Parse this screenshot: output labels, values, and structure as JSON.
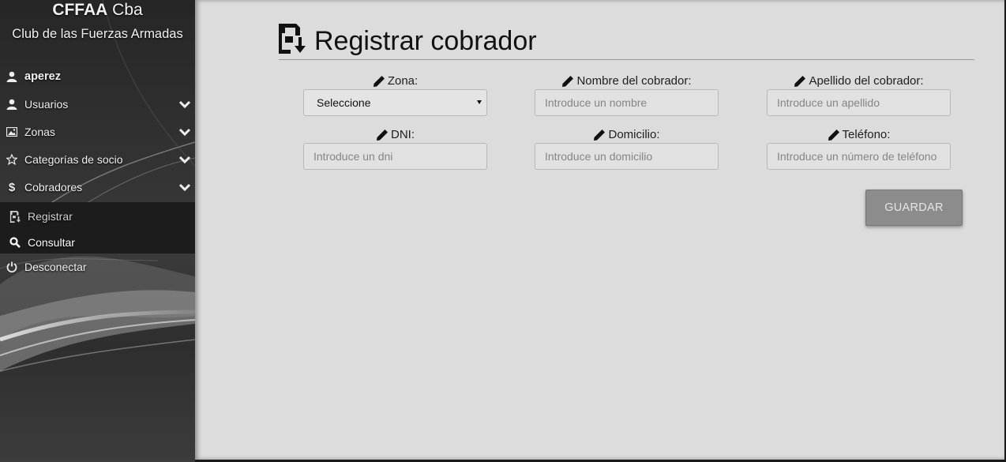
{
  "brand": {
    "title_bold": "CFFAA",
    "title_rest": " Cba",
    "subtitle": "Club de las Fuerzas Armadas"
  },
  "user": {
    "name": "aperez",
    "icon": "user-icon"
  },
  "nav": [
    {
      "label": "Usuarios",
      "icon": "user-icon"
    },
    {
      "label": "Zonas",
      "icon": "picture-icon"
    },
    {
      "label": "Categorías de socio",
      "icon": "star-icon"
    },
    {
      "label": "Cobradores",
      "icon": "dollar-icon"
    }
  ],
  "submenu": [
    {
      "label": "Registrar",
      "icon": "floppy-download-icon",
      "active": true
    },
    {
      "label": "Consultar",
      "icon": "search-icon",
      "active": false
    }
  ],
  "logout": {
    "label": "Desconectar",
    "icon": "power-icon"
  },
  "page": {
    "title": "Registrar cobrador",
    "icon": "floppy-download-icon"
  },
  "form": {
    "zona": {
      "label": "Zona:",
      "selected": "Seleccione"
    },
    "nombre": {
      "label": "Nombre del cobrador:",
      "placeholder": "Introduce un nombre"
    },
    "apellido": {
      "label": "Apellido del cobrador:",
      "placeholder": "Introduce un apellido"
    },
    "dni": {
      "label": "DNI:",
      "placeholder": "Introduce un dni"
    },
    "domicilio": {
      "label": "Domicilio:",
      "placeholder": "Introduce un domicilio"
    },
    "telefono": {
      "label": "Teléfono:",
      "placeholder": "Introduce un número de teléfono"
    },
    "save_label": "GUARDAR"
  }
}
